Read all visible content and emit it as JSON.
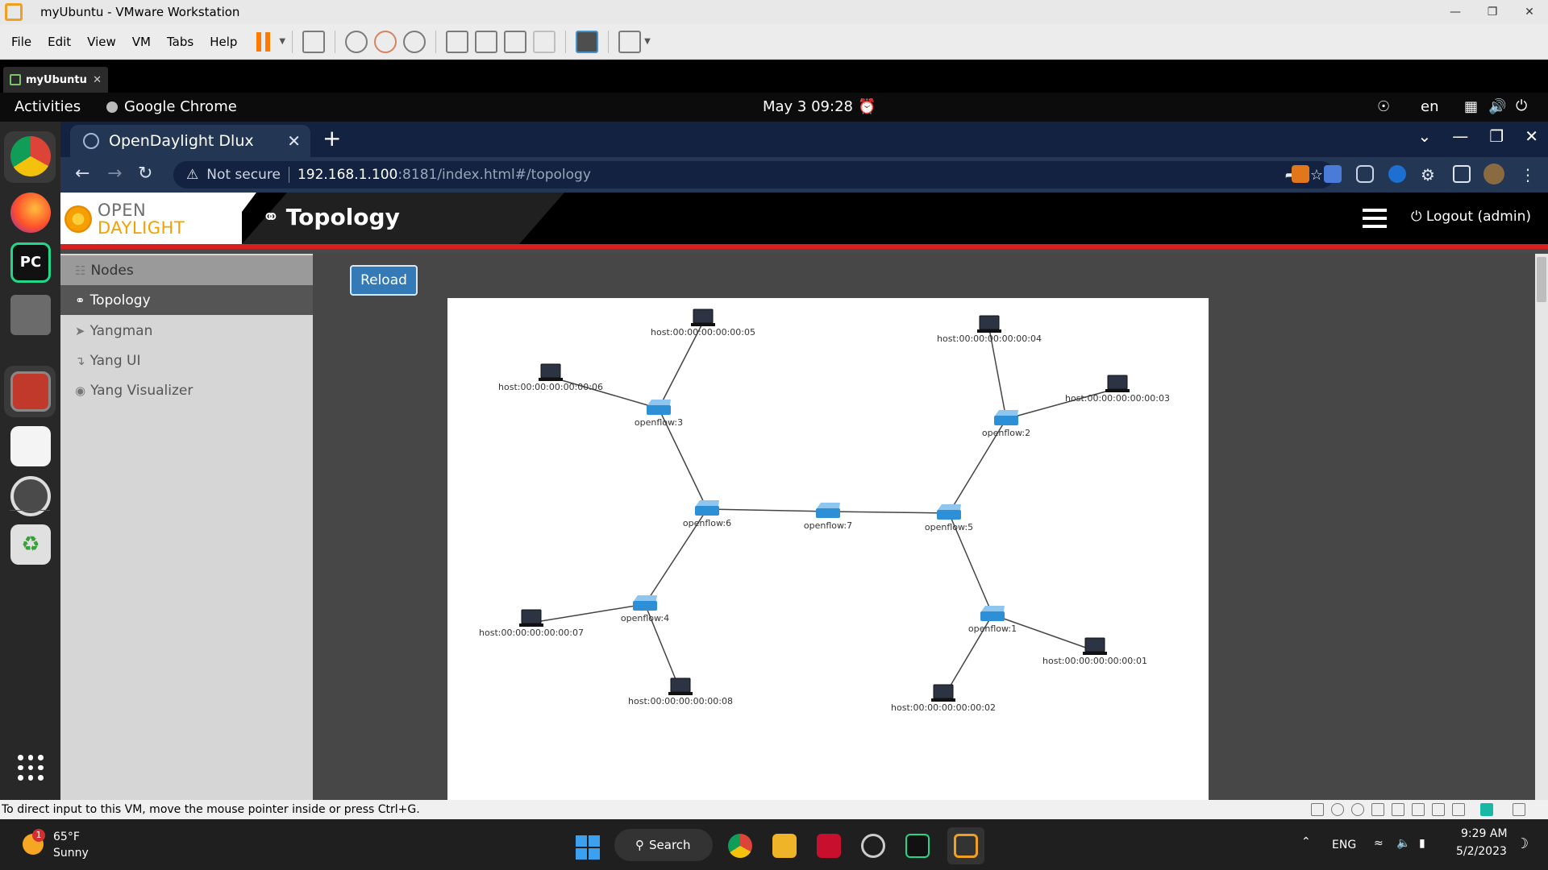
{
  "vmware": {
    "window_title": "myUbuntu - VMware Workstation",
    "menu": [
      "File",
      "Edit",
      "View",
      "VM",
      "Tabs",
      "Help"
    ],
    "tab_label": "myUbuntu",
    "status_text": "To direct input to this VM, move the mouse pointer inside or press Ctrl+G."
  },
  "ubuntu": {
    "activities": "Activities",
    "app_name": "Google Chrome",
    "clock": "May 3  09:28",
    "lang": "en"
  },
  "chrome": {
    "tab_title": "OpenDaylight Dlux",
    "security": "Not secure",
    "url_host": "192.168.1.100",
    "url_rest": ":8181/index.html#/topology"
  },
  "app": {
    "logo_top": "OPEN",
    "logo_bottom": "DAYLIGHT",
    "page_title": "Topology",
    "logout": "Logout (admin)",
    "reload": "Reload",
    "sidebar": [
      {
        "label": "Nodes",
        "icon": "sitemap-icon"
      },
      {
        "label": "Topology",
        "icon": "link-icon"
      },
      {
        "label": "Yangman",
        "icon": "rocket-icon"
      },
      {
        "label": "Yang UI",
        "icon": "level-down-icon"
      },
      {
        "label": "Yang Visualizer",
        "icon": "eye-icon"
      }
    ]
  },
  "topology": {
    "switches": [
      {
        "id": "openflow:1",
        "label": "openflow:1"
      },
      {
        "id": "openflow:2",
        "label": "openflow:2"
      },
      {
        "id": "openflow:3",
        "label": "openflow:3"
      },
      {
        "id": "openflow:4",
        "label": "openflow:4"
      },
      {
        "id": "openflow:5",
        "label": "openflow:5"
      },
      {
        "id": "openflow:6",
        "label": "openflow:6"
      },
      {
        "id": "openflow:7",
        "label": "openflow:7"
      }
    ],
    "hosts": [
      {
        "id": "h1",
        "label": "host:00:00:00:00:00:01"
      },
      {
        "id": "h2",
        "label": "host:00:00:00:00:00:02"
      },
      {
        "id": "h3",
        "label": "host:00:00:00:00:00:03"
      },
      {
        "id": "h4",
        "label": "host:00:00:00:00:00:04"
      },
      {
        "id": "h5",
        "label": "host:00:00:00:00:00:05"
      },
      {
        "id": "h6",
        "label": "host:00:00:00:00:00:06"
      },
      {
        "id": "h7",
        "label": "host:00:00:00:00:00:07"
      },
      {
        "id": "h8",
        "label": "host:00:00:00:00:00:08"
      }
    ],
    "links": [
      [
        "h5",
        "openflow:3"
      ],
      [
        "h6",
        "openflow:3"
      ],
      [
        "openflow:3",
        "openflow:6"
      ],
      [
        "h4",
        "openflow:2"
      ],
      [
        "h3",
        "openflow:2"
      ],
      [
        "openflow:2",
        "openflow:5"
      ],
      [
        "openflow:6",
        "openflow:7"
      ],
      [
        "openflow:7",
        "openflow:5"
      ],
      [
        "openflow:6",
        "openflow:4"
      ],
      [
        "h7",
        "openflow:4"
      ],
      [
        "h8",
        "openflow:4"
      ],
      [
        "openflow:5",
        "openflow:1"
      ],
      [
        "h1",
        "openflow:1"
      ],
      [
        "h2",
        "openflow:1"
      ]
    ]
  },
  "taskbar": {
    "weather_temp": "65°F",
    "weather_desc": "Sunny",
    "weather_badge": "1",
    "search": "Search",
    "lang": "ENG",
    "time": "9:29 AM",
    "date": "5/2/2023"
  }
}
